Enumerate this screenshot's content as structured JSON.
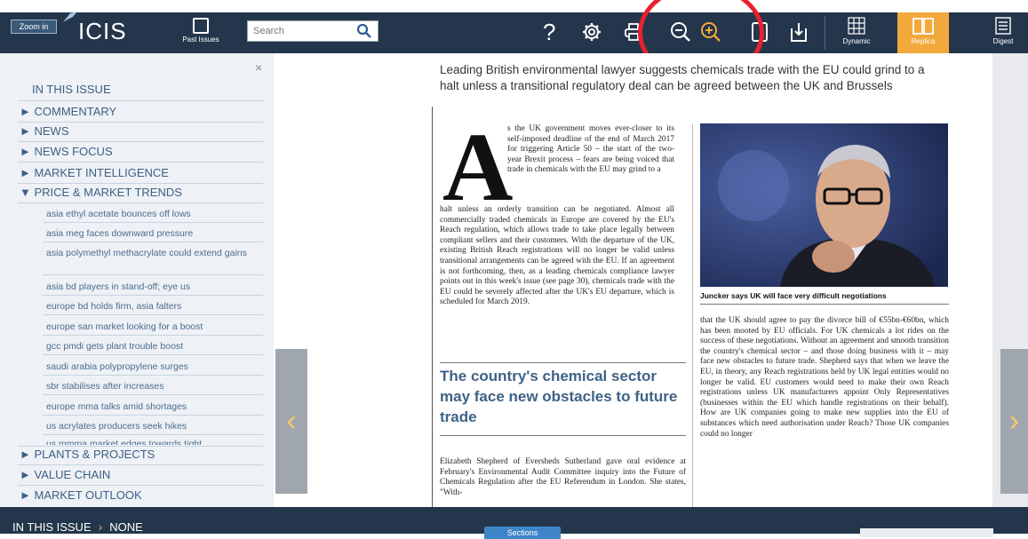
{
  "toolbar": {
    "zoom_label": "Zoom in",
    "logo": "ICIS",
    "past_issues": "Past Issues",
    "search_placeholder": "Search",
    "views": [
      "Dynamic",
      "Replica",
      "Digest"
    ],
    "active_view": "Replica",
    "icons": [
      "help-icon",
      "settings-icon",
      "print-icon",
      "zoom-out-icon",
      "zoom-in-icon",
      "single-page-icon",
      "download-icon"
    ],
    "accent_color": "#f2a93b",
    "bar_color": "#24364b",
    "annotation_color": "#e8212e"
  },
  "sidebar": {
    "close": "×",
    "title": "IN THIS ISSUE",
    "sections": [
      {
        "marker": "►",
        "label": "COMMENTARY"
      },
      {
        "marker": "►",
        "label": "NEWS"
      },
      {
        "marker": "►",
        "label": "NEWS FOCUS"
      },
      {
        "marker": "►",
        "label": "MARKET INTELLIGENCE"
      },
      {
        "marker": "▼",
        "label": "PRICE & MARKET TRENDS"
      }
    ],
    "sub_items": [
      "asia ethyl acetate bounces off lows",
      "asia meg faces downward pressure",
      "asia polymethyl methacrylate could extend gains",
      "asia bd players in stand-off; eye us",
      "europe bd holds firm, asia falters",
      "europe san market looking for a boost",
      "gcc pmdi gets plant trouble boost",
      "saudi arabia polypropylene surges",
      "sbr stabilises after increases",
      "europe mma talks amid shortages",
      "us acrylates producers seek hikes",
      "us mmma market edges towards tight"
    ],
    "bottom_sections": [
      {
        "marker": "►",
        "label": "PLANTS & PROJECTS"
      },
      {
        "marker": "►",
        "label": "VALUE CHAIN"
      },
      {
        "marker": "►",
        "label": "MARKET OUTLOOK"
      }
    ]
  },
  "article": {
    "headline": "Leading British environmental lawyer suggests chemicals trade with the EU could grind to a halt unless a transitional regulatory deal can be agreed between the UK and Brussels",
    "dropcap": "A",
    "intro": "s the UK government moves ever-closer to its self-imposed deadline of the end of March 2017 for triggering Article 50 – the start of the two-year Brexit process – fears are being voiced that trade in chemicals with the EU may grind to a",
    "intro_cont": "halt unless an orderly transition can be negotiated. Almost all commercially traded chemicals in Europe are covered by the EU's Reach regulation, which allows trade to take place legally between compliant sellers and their customers. With the departure of the UK, existing British Reach registrations will no longer be valid unless transitional arrangements can be agreed with the EU. If an agreement is not forthcoming, then, as a leading chemicals compliance lawyer points out in this week's issue (see page 30), chemicals trade with the EU could be severely affected after the UK's EU departure, which is scheduled for March 2019.",
    "pullquote": "The country's chemical sector may face new obstacles to future trade",
    "body_left": "Elizabeth Shepherd of Eversheds Sutherland gave oral evidence at February's Environmental Audit Committee inquiry into the Future of Chemicals Regulation after the EU Referendum in London. She states, \"With-",
    "caption": "Juncker says UK will face very difficult negotiations",
    "body_right": "that the UK should agree to pay the divorce bill of €55bn-€60bn, which has been mooted by EU officials. For UK chemicals a lot rides on the success of these negotiations. Without an agreement and smooth transition the country's chemical sector – and those doing business with it – may face new obstacles to future trade. Shepherd says that when we leave the EU, in theory, any Reach registrations held by UK legal entities would no longer be valid. EU customers would need to make their own Reach registrations unless UK manufacturers appoint Only Representatives (businesses within the EU which handle registrations on their behalf). How are UK companies going to make new supplies into the EU of substances which need authorisation under Reach? Those UK companies could no longer"
  },
  "nav": {
    "prev": "‹",
    "next": "›"
  },
  "footer": {
    "crumb_root": "IN THIS ISSUE",
    "crumb_sep": "›",
    "crumb_current": "NONE",
    "sections_tab": "Sections"
  }
}
